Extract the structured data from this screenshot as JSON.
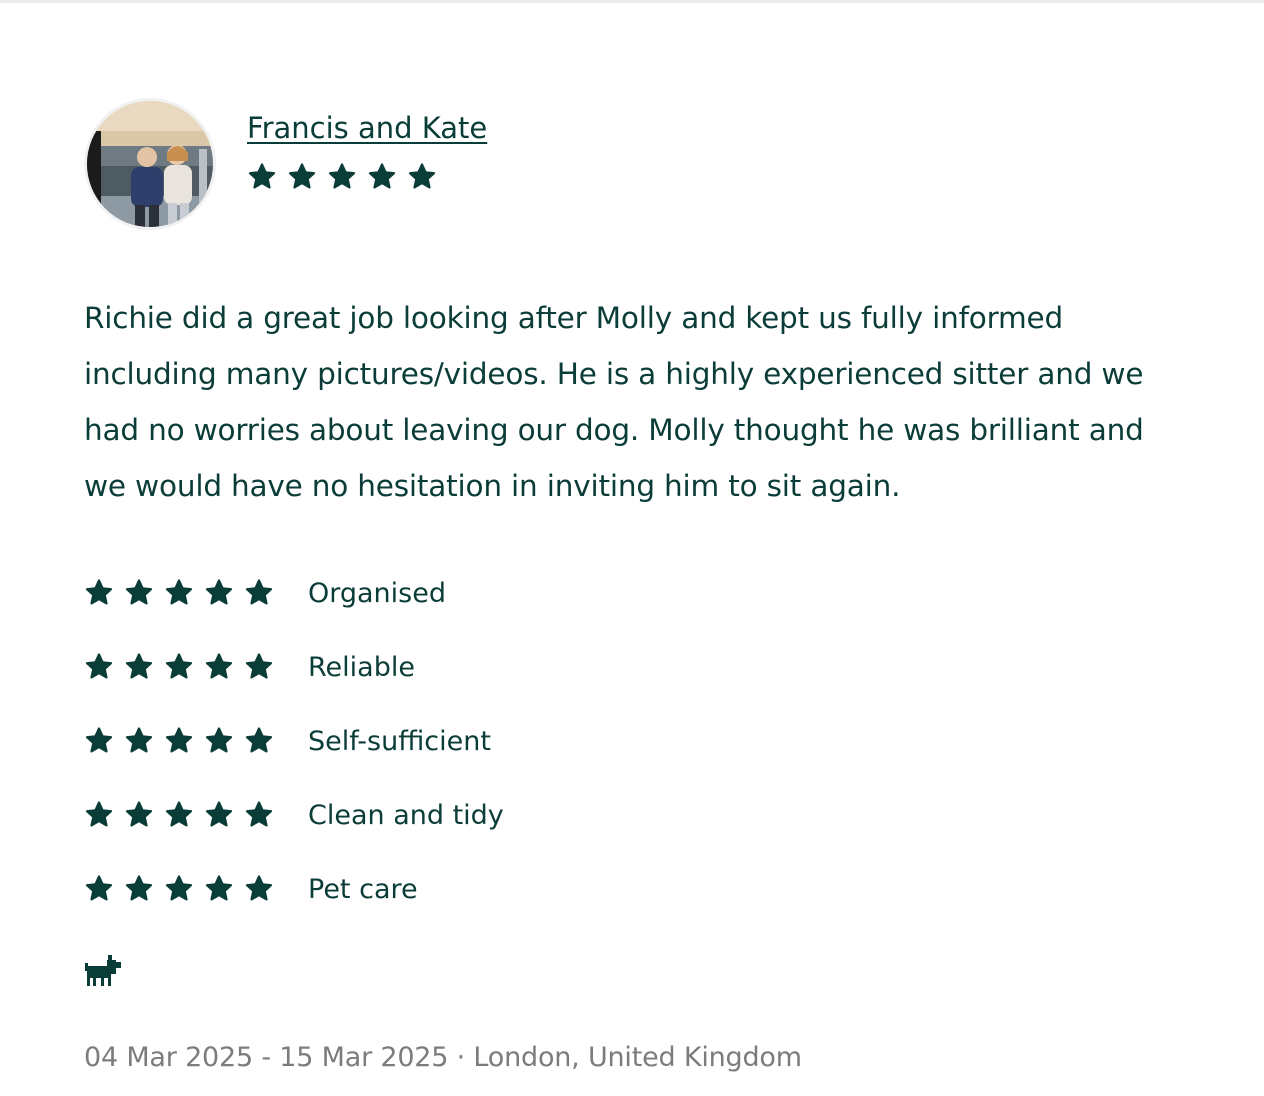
{
  "reviewer": {
    "name": "Francis and Kate",
    "overall_rating": 5,
    "avatar_icon": "reviewer-photo"
  },
  "review": {
    "text": "Richie did a great job looking after Molly and kept us fully informed including many pictures/videos. He is a highly experienced sitter and we had no worries about leaving our dog. Molly thought he was brilliant and we would have no hesitation in inviting him to sit again."
  },
  "ratings": [
    {
      "label": "Organised",
      "stars": 5
    },
    {
      "label": "Reliable",
      "stars": 5
    },
    {
      "label": "Self-sufficient",
      "stars": 5
    },
    {
      "label": "Clean and tidy",
      "stars": 5
    },
    {
      "label": "Pet care",
      "stars": 5
    }
  ],
  "pet": {
    "icon": "dog-icon"
  },
  "stay": {
    "meta": "04 Mar 2025 - 15 Mar 2025 · London, United Kingdom"
  },
  "colors": {
    "primary": "#0b3d38",
    "muted": "#7c7c7c",
    "star": "#0b3d38"
  }
}
